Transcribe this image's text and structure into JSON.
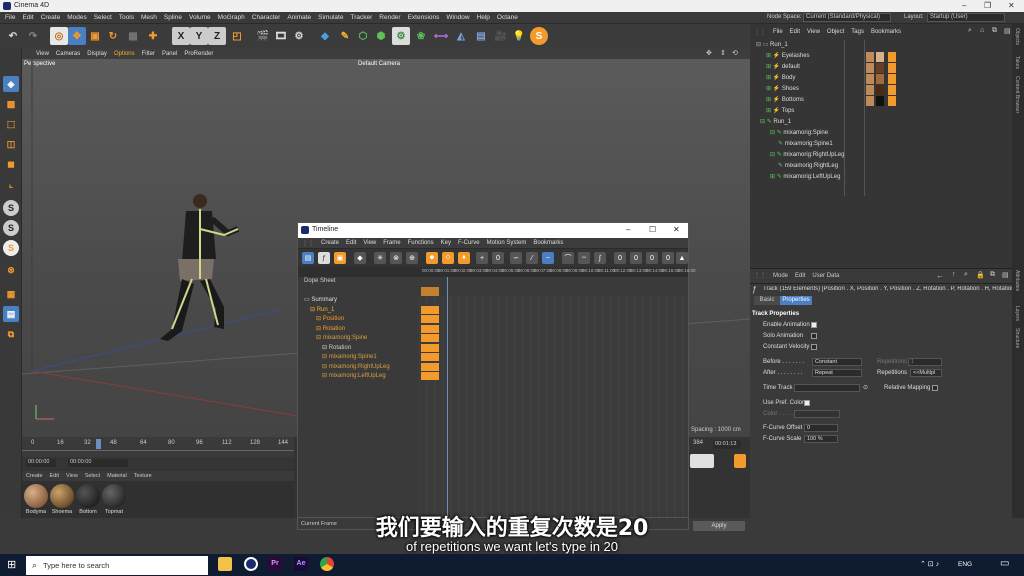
{
  "window": {
    "title": "Cinema 4D",
    "controls": [
      "–",
      "❐",
      "✕"
    ]
  },
  "menu": [
    "File",
    "Edit",
    "Create",
    "Modes",
    "Select",
    "Tools",
    "Mesh",
    "Spline",
    "Volume",
    "MoGraph",
    "Character",
    "Animate",
    "Simulate",
    "Tracker",
    "Render",
    "Extensions",
    "Window",
    "Help",
    "Octane"
  ],
  "nodespace": {
    "label": "Node Space:",
    "value": "Current (Standard/Physical)"
  },
  "layout": {
    "label": "Layout:",
    "value": "Startup (User)"
  },
  "toolbar_axes": [
    "X",
    "Y",
    "Z"
  ],
  "viewport": {
    "menu": [
      "View",
      "Cameras",
      "Display",
      "Options",
      "Filter",
      "Panel",
      "ProRender"
    ],
    "name": "Perspective",
    "camera": "Default Camera"
  },
  "ruler": {
    "ticks": [
      "0",
      "16",
      "32",
      "48",
      "64",
      "80",
      "96",
      "112",
      "128",
      "144"
    ],
    "start": "00:00:00",
    "current": "00:00:00"
  },
  "materials": {
    "menu": [
      "Create",
      "Edit",
      "View",
      "Select",
      "Material",
      "Texture"
    ],
    "items": [
      "Bodyma",
      "Shoema",
      "Bottom",
      "Topmat"
    ]
  },
  "timeline": {
    "title": "Timeline",
    "menu": [
      "Create",
      "Edit",
      "View",
      "Frame",
      "Functions",
      "Key",
      "F-Curve",
      "Motion System",
      "Bookmarks"
    ],
    "mode": "Dope Sheet",
    "frames": [
      "00:00:00",
      "00:01:00",
      "00:02:00",
      "00:03:00",
      "00:04:00",
      "00:05:00",
      "00:06:00",
      "00:07:00",
      "00:08:00",
      "00:09:00",
      "00:10:00",
      "00:11:00",
      "00:12:00",
      "00:13:00",
      "00:14:00",
      "00:15:00",
      "00:16:00"
    ],
    "tracks": [
      "Summary",
      "Run_1",
      "Position",
      "Rotation",
      "mixamorig:Spine",
      "Rotation",
      "mixamorig:Spine1",
      "mixamorig:RightUpLeg",
      "mixamorig:LeftUpLeg"
    ],
    "spacing": "Spacing : 1000 cm",
    "current_frame_label": "Current Frame",
    "frame_val": "384",
    "time_val": "00:01:13"
  },
  "objects": {
    "menu": [
      "File",
      "Edit",
      "View",
      "Object",
      "Tags",
      "Bookmarks"
    ],
    "items": [
      "Run_1",
      "Eyelashes",
      "default",
      "Body",
      "Shoes",
      "Bottoms",
      "Tops",
      "Run_1",
      "mixamorig:Spine",
      "mixamorig:Spine1",
      "mixamorig:RightUpLeg",
      "mixamorig:RightLeg",
      "mixamorig:LeftUpLeg"
    ]
  },
  "attributes": {
    "menu": [
      "Mode",
      "Edit",
      "User Data"
    ],
    "track": "Track (159 Elements) [Position . X, Position . Y, Position . Z, Rotation . P, Rotation . H, Rotation . B,",
    "tabs": [
      "Basic",
      "Properties"
    ],
    "section": "Track Properties",
    "enable_animation": "Enable Animation",
    "solo_animation": "Solo Animation",
    "constant_velocity": "Constant Velocity",
    "before": "Before . . . . . . .",
    "before_value": "Constant",
    "repetitions": "Repetitions",
    "rep_value": "1",
    "after": "After . . . . . . . .",
    "after_value": "Repeat",
    "repetitions2": "Repetitions",
    "rep2_value": "<<Multipl",
    "time_track": "Time Track",
    "relative_mapping": "Relative Mapping",
    "use_pref_color": "Use Pref. Color",
    "color": "Color . . . . . .",
    "fcurve_offset": "F-Curve Offset",
    "fcurve_offset_value": "0",
    "fcurve_scale": "F-Curve Scale",
    "fcurve_scale_value": "100 %",
    "apply": "Apply"
  },
  "sidetabs": [
    "Objects",
    "Takes",
    "Content Browser",
    "Attributes",
    "Layers",
    "Structure"
  ],
  "subtitles": {
    "zh": "我们要输入的重复次数是20",
    "en": "of repetitions we want let's type in 20"
  },
  "taskbar": {
    "search": "Type here to search",
    "lang": "ENG"
  },
  "colors": {
    "accent": "#f39a2c",
    "blue": "#4a7fc1"
  }
}
